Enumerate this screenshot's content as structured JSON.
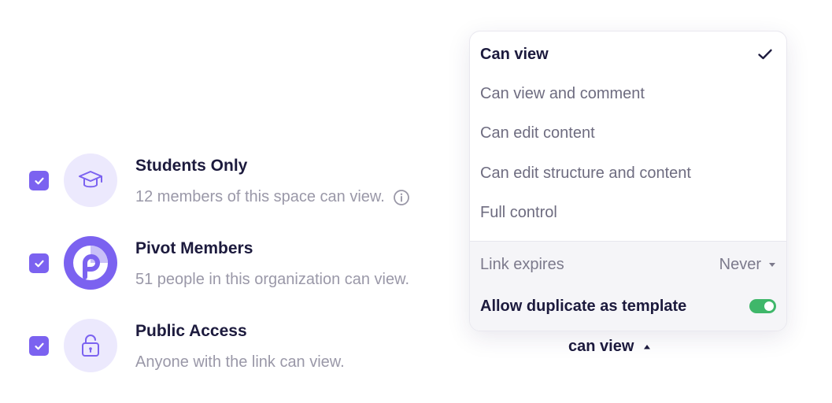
{
  "access_rows": [
    {
      "title": "Students Only",
      "subtitle": "12 members of this space can view.",
      "checked": true,
      "icon": "graduation-cap-icon",
      "has_info": true
    },
    {
      "title": "Pivot Members",
      "subtitle": "51 people in this organization can view.",
      "checked": true,
      "icon": "pivot-logo-icon"
    },
    {
      "title": "Public Access",
      "subtitle": "Anyone with the link can view.",
      "checked": true,
      "icon": "lock-icon"
    }
  ],
  "permission_trigger": {
    "label": "can view",
    "icon": "caret-up-icon"
  },
  "dropdown": {
    "options": [
      {
        "label": "Can view",
        "selected": true
      },
      {
        "label": "Can view and comment"
      },
      {
        "label": "Can edit content"
      },
      {
        "label": "Can edit structure and content"
      },
      {
        "label": "Full control"
      }
    ],
    "link_expires": {
      "label": "Link expires",
      "value": "Never"
    },
    "duplicate_template": {
      "label": "Allow duplicate as template",
      "enabled": true
    }
  },
  "colors": {
    "accent": "#7b62f0",
    "avatar_bg": "#ece9fd",
    "toggle_on": "#3fb76a",
    "text_primary": "#1c1a3d",
    "text_muted": "#9a98a8"
  }
}
